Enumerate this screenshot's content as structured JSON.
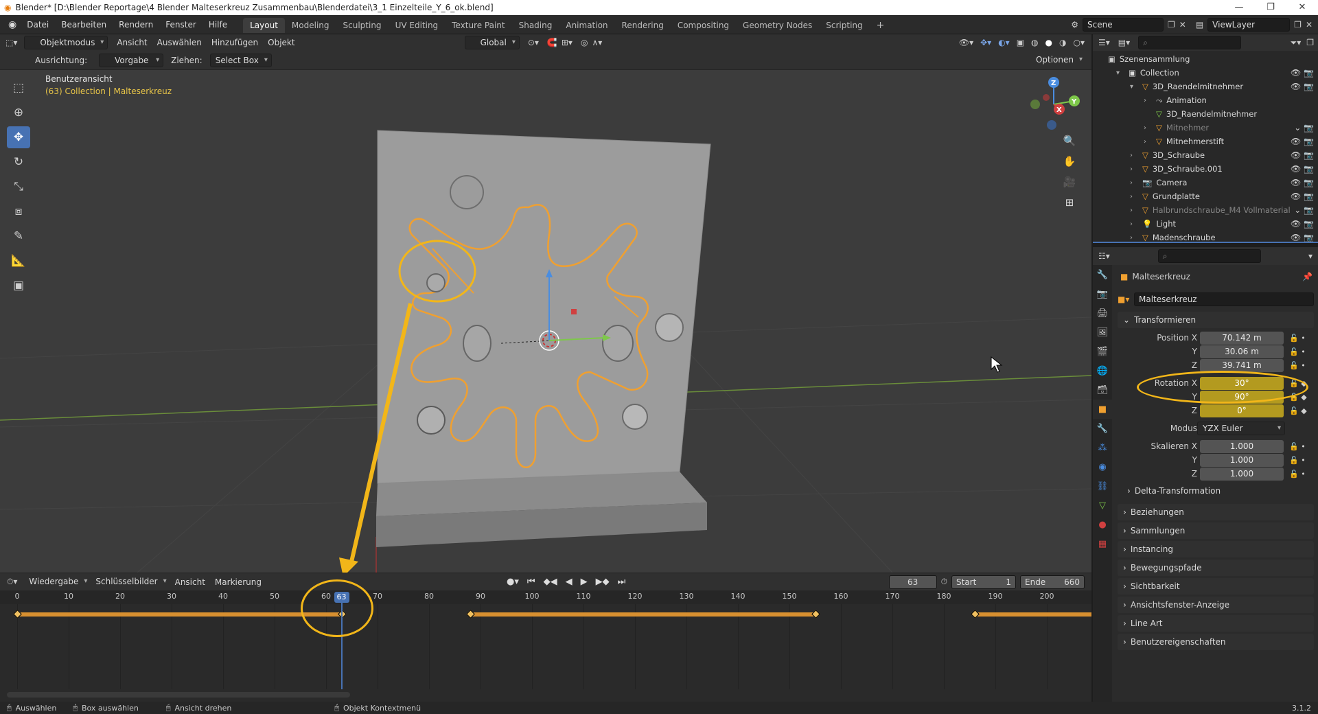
{
  "window": {
    "title": "Blender* [D:\\Blender Reportage\\4 Blender Malteserkreuz Zusammenbau\\Blenderdatei\\3_1 Einzelteile_Y_6_ok.blend]",
    "controls": [
      "—",
      "❐",
      "✕"
    ]
  },
  "menu": [
    "Datei",
    "Bearbeiten",
    "Rendern",
    "Fenster",
    "Hilfe"
  ],
  "workspaces": [
    "Layout",
    "Modeling",
    "Sculpting",
    "UV Editing",
    "Texture Paint",
    "Shading",
    "Animation",
    "Rendering",
    "Compositing",
    "Geometry Nodes",
    "Scripting"
  ],
  "workspace_add": "+",
  "scene": {
    "name": "Scene",
    "view_layer": "ViewLayer"
  },
  "viewport_header": {
    "mode": "Objektmodus",
    "menus": [
      "Ansicht",
      "Auswählen",
      "Hinzufügen",
      "Objekt"
    ],
    "orientation": "Global"
  },
  "tool_header": {
    "orientation_label": "Ausrichtung:",
    "orientation_value": "Vorgabe",
    "drag_label": "Ziehen:",
    "drag_value": "Select Box",
    "options": "Optionen"
  },
  "viewport": {
    "view_name": "Benutzeransicht",
    "collection_info": "(63) Collection | Malteserkreuz",
    "gizmo": {
      "x": "X",
      "y": "Y",
      "z": "Z"
    }
  },
  "timeline": {
    "menus": [
      "Wiedergabe",
      "Schlüsselbilder",
      "Ansicht",
      "Markierung"
    ],
    "current_frame": "63",
    "start_label": "Start",
    "start": "1",
    "end_label": "Ende",
    "end": "660",
    "ticks": [
      "0",
      "10",
      "20",
      "30",
      "40",
      "50",
      "60",
      "70",
      "80",
      "90",
      "100",
      "110",
      "120",
      "130",
      "140",
      "150",
      "160",
      "170",
      "180",
      "190",
      "200",
      "210"
    ],
    "keyframe_ranges": [
      [
        0,
        63
      ],
      [
        88,
        155
      ],
      [
        186,
        213
      ]
    ]
  },
  "status": {
    "select": "Auswählen",
    "box_select": "Box auswählen",
    "rotate_view": "Ansicht drehen",
    "context_menu": "Objekt Kontextmenü",
    "version": "3.1.2"
  },
  "outliner": {
    "root": "Szenensammlung",
    "items": [
      {
        "label": "Collection",
        "indent": 1,
        "dim": false,
        "icon": "collection-icon"
      },
      {
        "label": "3D_Raendelmitnehmer",
        "indent": 2,
        "dim": false,
        "icon": "mesh-object-icon"
      },
      {
        "label": "Animation",
        "indent": 3,
        "dim": false,
        "icon": "animation-icon"
      },
      {
        "label": "3D_Raendelmitnehmer",
        "indent": 3,
        "dim": false,
        "icon": "mesh-data-icon"
      },
      {
        "label": "Mitnehmer",
        "indent": 3,
        "dim": true,
        "icon": "mesh-object-icon"
      },
      {
        "label": "Mitnehmerstift",
        "indent": 3,
        "dim": false,
        "icon": "mesh-object-icon"
      },
      {
        "label": "3D_Schraube",
        "indent": 2,
        "dim": false,
        "icon": "mesh-object-icon"
      },
      {
        "label": "3D_Schraube.001",
        "indent": 2,
        "dim": false,
        "icon": "mesh-object-icon"
      },
      {
        "label": "Camera",
        "indent": 2,
        "dim": false,
        "icon": "camera-icon"
      },
      {
        "label": "Grundplatte",
        "indent": 2,
        "dim": false,
        "icon": "mesh-object-icon"
      },
      {
        "label": "Halbrundschraube_M4 Vollmaterial",
        "indent": 2,
        "dim": true,
        "icon": "mesh-object-icon"
      },
      {
        "label": "Light",
        "indent": 2,
        "dim": false,
        "icon": "light-icon"
      },
      {
        "label": "Madenschraube",
        "indent": 2,
        "dim": false,
        "icon": "mesh-object-icon"
      }
    ]
  },
  "properties": {
    "object_name": "Malteserkreuz",
    "object_field": "Malteserkreuz",
    "transform_title": "Transformieren",
    "position": {
      "label_x": "Position X",
      "x": "70.142 m",
      "y": "30.06 m",
      "z": "39.741 m"
    },
    "rotation": {
      "label_x": "Rotation X",
      "x": "30°",
      "y": "90°",
      "z": "0°"
    },
    "mode_label": "Modus",
    "mode": "YZX Euler",
    "scale": {
      "label_x": "Skalieren X",
      "x": "1.000",
      "y": "1.000",
      "z": "1.000"
    },
    "axis_y": "Y",
    "axis_z": "Z",
    "delta": "Delta-Transformation",
    "panels": [
      "Beziehungen",
      "Sammlungen",
      "Instancing",
      "Bewegungspfade",
      "Sichtbarkeit",
      "Ansichtsfenster-Anzeige",
      "Line Art",
      "Benutzereigenschaften"
    ]
  },
  "colors": {
    "accent": "#4772b3",
    "selection": "#f0a030",
    "keyframe": "#d89030",
    "callout": "#f2b619",
    "animated_field": "#b39a1f"
  }
}
